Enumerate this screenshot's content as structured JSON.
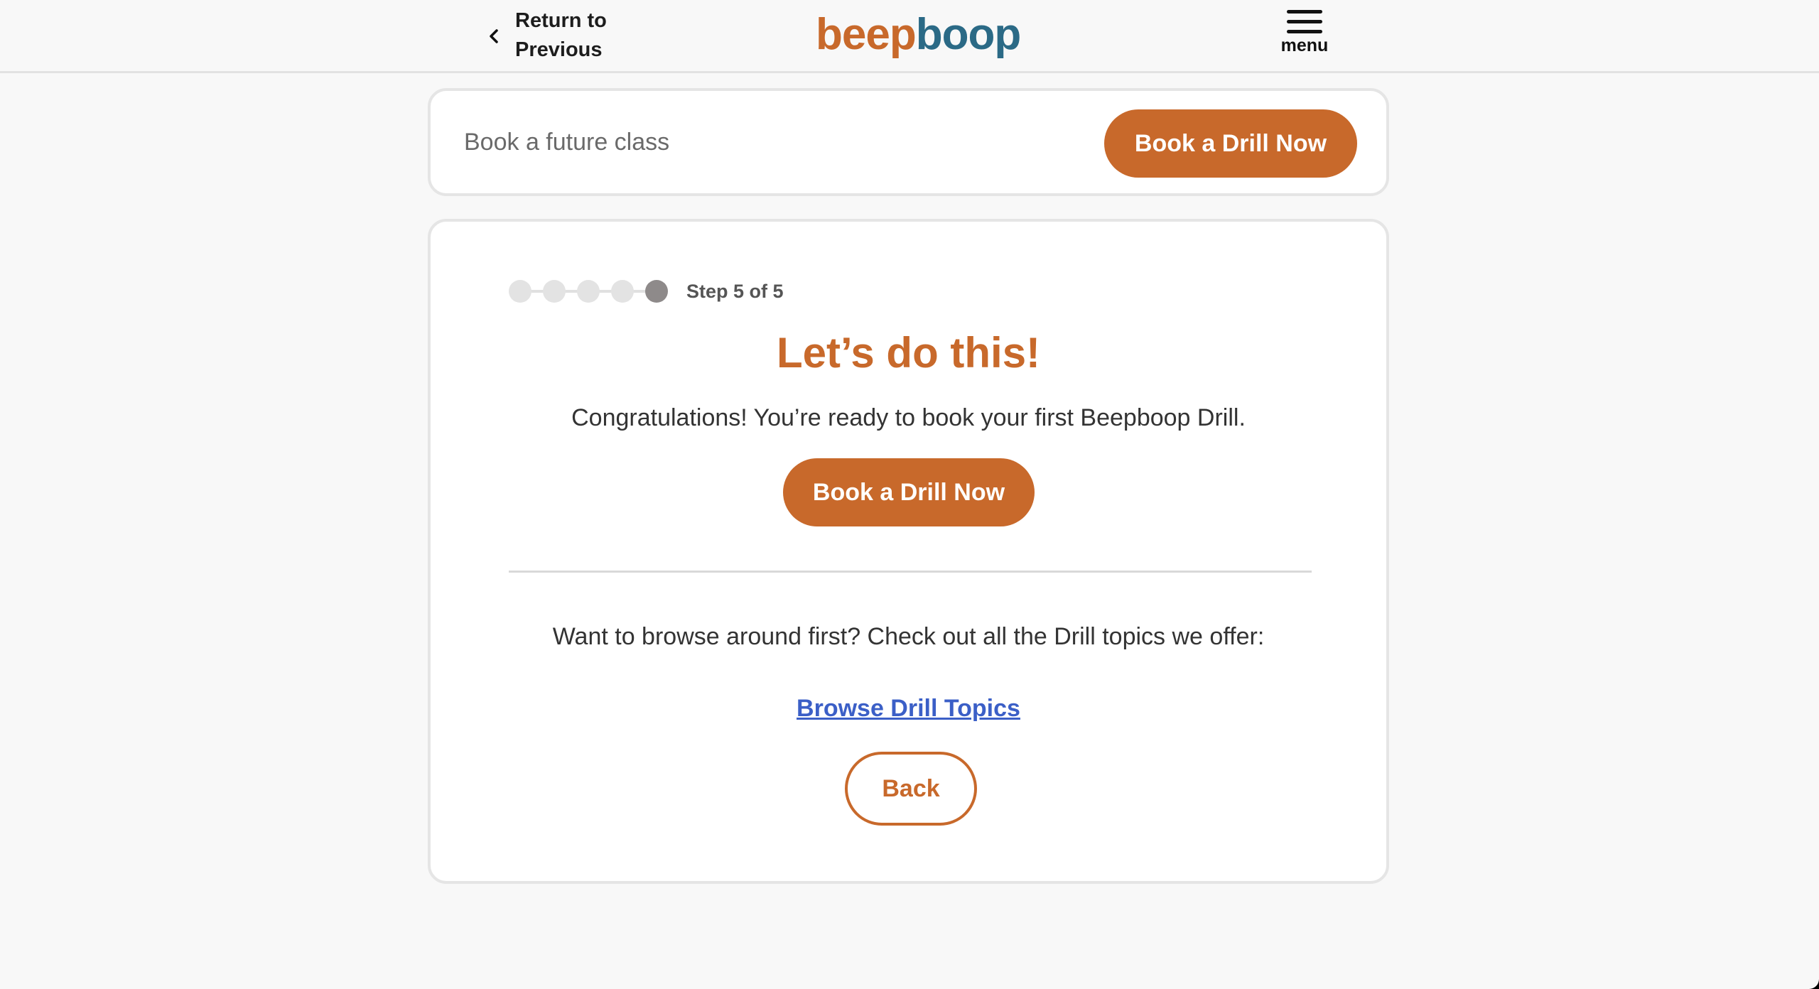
{
  "header": {
    "back_label": "Return to Previous",
    "logo_part1": "beep",
    "logo_part2": "boop",
    "menu_label": "menu"
  },
  "top_card": {
    "text": "Book a future class",
    "button_label": "Book a Drill Now"
  },
  "main_card": {
    "step_label": "Step 5 of 5",
    "steps_total": 5,
    "current_step": 5,
    "heading": "Let’s do this!",
    "message": "Congratulations! You’re ready to book your first Beepboop Drill.",
    "book_button_label": "Book a Drill Now",
    "browse_prompt": "Want to browse around first? Check out all the Drill topics we offer:",
    "browse_link_label": "Browse Drill Topics",
    "back_button_label": "Back"
  },
  "colors": {
    "brand_orange": "#c8692b",
    "brand_blue": "#2b6a86",
    "link_blue": "#3b5fc7",
    "step_active": "#8e8a8a",
    "step_inactive": "#e3e3e3"
  }
}
